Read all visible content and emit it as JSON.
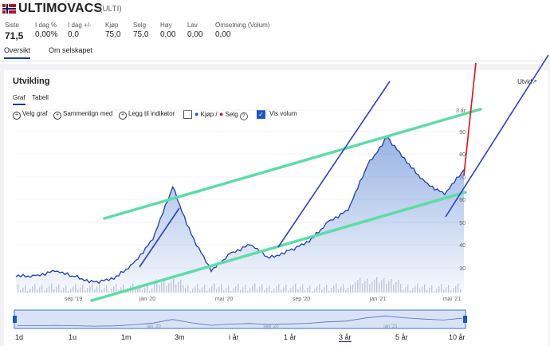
{
  "header": {
    "title": "ULTIMOVACS",
    "ticker": "(ULTI)",
    "stats": [
      {
        "label": "Siste",
        "value": "71,5"
      },
      {
        "label": "I dag %",
        "value": "0,00%"
      },
      {
        "label": "I dag +/-",
        "value": "0,0"
      },
      {
        "label": "Kjøp",
        "value": "75,0"
      },
      {
        "label": "Selg",
        "value": "75,0"
      },
      {
        "label": "Høy",
        "value": "0,00"
      },
      {
        "label": "Lav",
        "value": "0,00"
      },
      {
        "label": "Omsetning (Volum)",
        "value": "0,00"
      }
    ]
  },
  "tabs": [
    "Oversikt",
    "Om selskapet"
  ],
  "chart_card": {
    "title": "Utvikling",
    "expand_label": "Utvid",
    "subtabs": [
      "Graf",
      "Tabell"
    ],
    "toolbar": {
      "choose_chart": "Velg graf",
      "compare": "Sammenlign med",
      "add_indicator": "Legg til indikator",
      "buy": "Kjøp",
      "separator": "/",
      "sell": "Selg",
      "help": "?",
      "show_volume": "Vis volum"
    },
    "colors": {
      "buy": "#1a57c4",
      "sell": "#d0103a",
      "line": "#1a3fa8"
    }
  },
  "periods": [
    "1d",
    "1u",
    "1m",
    "3m",
    "i år",
    "1 år",
    "3 år",
    "5 år",
    "10 år"
  ],
  "active_period": "3 år",
  "chart_data": {
    "type": "area",
    "y_ticks": [
      "3 år",
      "90",
      "80",
      "70",
      "60",
      "50",
      "40",
      "30"
    ],
    "x_ticks": [
      "sep '19",
      "jan '20",
      "mai '20",
      "sep '20",
      "jan '21",
      "mai '21"
    ],
    "navigator_ticks": [
      "jan '20",
      "sep '20",
      "jan '21"
    ],
    "price": [
      [
        "2019-06",
        31
      ],
      [
        "2019-07",
        31.5
      ],
      [
        "2019-08",
        33
      ],
      [
        "2019-09",
        31
      ],
      [
        "2019-10",
        29
      ],
      [
        "2019-11",
        30
      ],
      [
        "2019-12",
        36
      ],
      [
        "2020-01",
        45
      ],
      [
        "2020-02",
        65
      ],
      [
        "2020-03",
        47
      ],
      [
        "2020-04",
        33
      ],
      [
        "2020-05",
        40
      ],
      [
        "2020-06",
        43
      ],
      [
        "2020-07",
        38
      ],
      [
        "2020-08",
        41
      ],
      [
        "2020-09",
        44
      ],
      [
        "2020-10",
        52
      ],
      [
        "2020-11",
        56
      ],
      [
        "2020-12",
        73
      ],
      [
        "2021-01",
        84
      ],
      [
        "2021-02",
        74
      ],
      [
        "2021-03",
        67
      ],
      [
        "2021-04",
        62
      ],
      [
        "2021-05",
        71.5
      ]
    ],
    "y_range": [
      25,
      98
    ]
  }
}
